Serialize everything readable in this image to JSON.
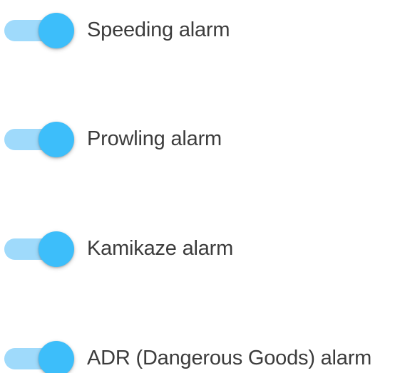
{
  "colors": {
    "track": "#9fdafb",
    "thumb": "#3dbefa",
    "label_text": "#3c3c3c",
    "background": "#ffffff"
  },
  "alarms": [
    {
      "label": "Speeding alarm",
      "enabled": true
    },
    {
      "label": "Prowling alarm",
      "enabled": true
    },
    {
      "label": "Kamikaze alarm",
      "enabled": true
    },
    {
      "label": "ADR (Dangerous Goods) alarm",
      "enabled": true
    }
  ]
}
